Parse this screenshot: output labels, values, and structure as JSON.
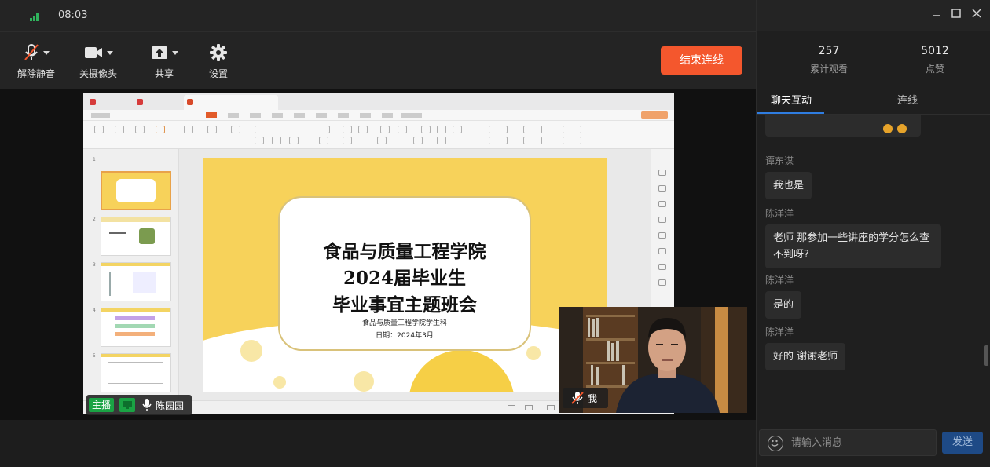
{
  "titlebar": {
    "time": "08:03"
  },
  "toolbar": {
    "unmute_label": "解除静音",
    "camera_off_label": "关摄像头",
    "share_label": "共享",
    "settings_label": "设置",
    "end_connection_label": "结束连线"
  },
  "colors": {
    "accent": "#f4572d",
    "host_green": "#1aa344",
    "tab_blue": "#2f7de1"
  },
  "share": {
    "slide_title": "食品与质量工程学院\n2024届毕业生\n毕业事宜主题班会",
    "slide_subtitle": "食品与质量工程学院学生科\n日期：2024年3月"
  },
  "presenter": {
    "host_tag": "主播",
    "name": "陈园园"
  },
  "self_view": {
    "name": "我"
  },
  "stats": {
    "views_count": "257",
    "views_label": "累计观看",
    "likes_count": "5012",
    "likes_label": "点赞"
  },
  "tabs": {
    "chat": "聊天互动",
    "link": "连线"
  },
  "chat": {
    "messages": [
      {
        "sender": "谭东谋",
        "text": "我也是"
      },
      {
        "sender": "陈洋洋",
        "text": "老师 那参加一些讲座的学分怎么查不到呀?"
      },
      {
        "sender": "陈洋洋",
        "text": "是的"
      },
      {
        "sender": "陈洋洋",
        "text": "好的 谢谢老师"
      }
    ],
    "input_placeholder": "请输入消息",
    "send_label": "发送"
  }
}
